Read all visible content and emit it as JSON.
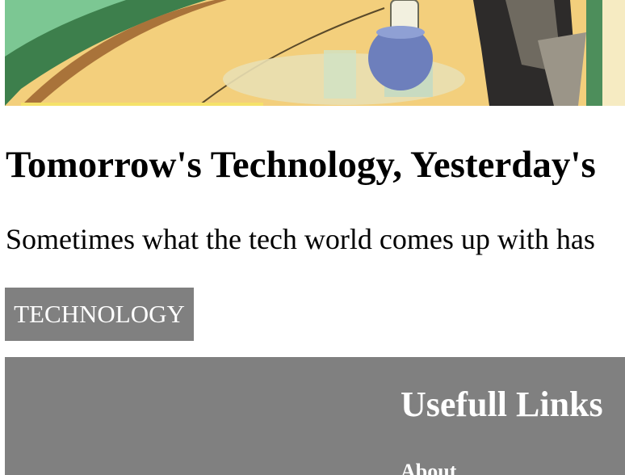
{
  "article": {
    "headline": "Tomorrow's Technology, Yesterday's",
    "excerpt": "Sometimes what the tech world comes up with has",
    "tag": "TECHNOLOGY"
  },
  "footer": {
    "title": "Usefull Links",
    "links": [
      "About"
    ]
  },
  "colors": {
    "tag_bg": "#808080",
    "footer_bg": "#808080",
    "text": "#000000",
    "footer_text": "#ffffff"
  },
  "icons": {
    "hero": "retro-technology-illustration"
  }
}
